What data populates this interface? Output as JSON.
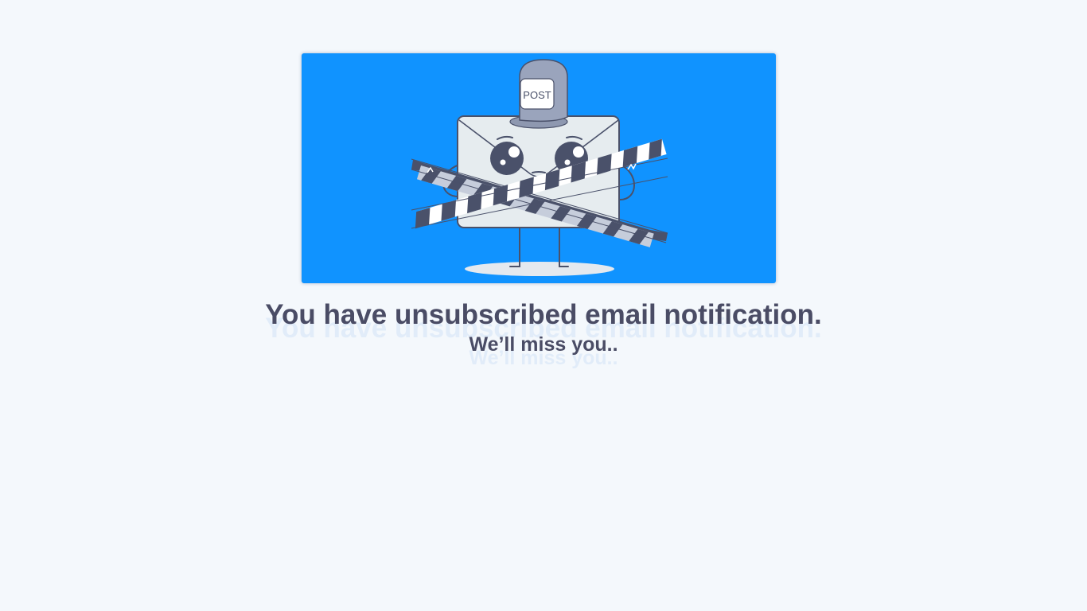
{
  "hero": {
    "illustration": "unsubscribed-envelope-illustration",
    "cap_label": "POST",
    "background_color": "#1093ff"
  },
  "message": {
    "headline": "You have unsubscribed email notification.",
    "subline": "We’ll miss you.."
  },
  "colors": {
    "page_background": "#f4f8fc",
    "text": "#4a4c65",
    "envelope": "#e6ecef",
    "outline": "#4a516a",
    "cap": "#9aa4bc"
  }
}
